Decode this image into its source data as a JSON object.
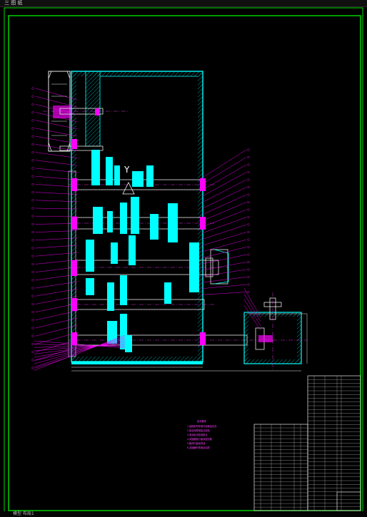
{
  "window": {
    "title": "三 图  纸"
  },
  "drawing": {
    "view_marker": "Y",
    "notes_title": "技术要求",
    "notes": [
      "1.装配前所有零件用煤油清洗",
      "2.啮合侧隙用铅丝检验",
      "3.用涂色法检验斑点",
      "4.减速器剖分面涂密封胶",
      "5.箱体内装润滑油",
      "6.减速器外表面涂油漆"
    ]
  },
  "status": {
    "text": "模型  布局1"
  },
  "colors": {
    "frame": "#00e000",
    "housing": "#00ffff",
    "gear": "#00ffff",
    "highlight": "#ff00ff",
    "shaft": "#e8e8e8",
    "leader": "#ff00ff",
    "hatch": "#00bfbf",
    "dim": "#e8e8e8"
  }
}
